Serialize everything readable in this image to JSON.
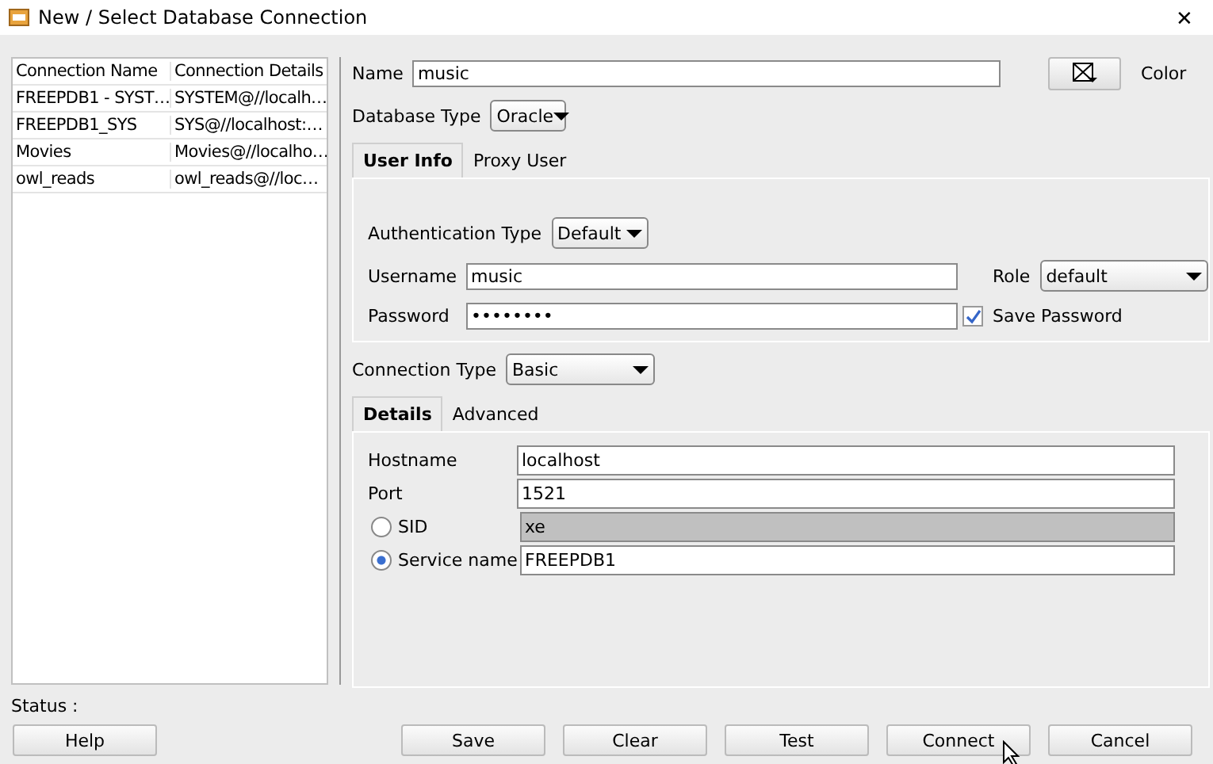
{
  "window": {
    "title": "New / Select Database Connection",
    "close": "✕"
  },
  "connections": {
    "columns": [
      "Connection Name",
      "Connection Details"
    ],
    "rows": [
      {
        "name": "FREEPDB1 - SYST…",
        "details": "SYSTEM@//localh…"
      },
      {
        "name": "FREEPDB1_SYS",
        "details": "SYS@//localhost:…"
      },
      {
        "name": "Movies",
        "details": "Movies@//localho…"
      },
      {
        "name": "owl_reads",
        "details": "owl_reads@//loc…"
      }
    ]
  },
  "name": {
    "label": "Name",
    "value": "music"
  },
  "color": {
    "label": "Color"
  },
  "database_type": {
    "label": "Database Type",
    "value": "Oracle"
  },
  "user_tabs": [
    {
      "label": "User Info",
      "selected": true
    },
    {
      "label": "Proxy User",
      "selected": false
    }
  ],
  "authentication_type": {
    "label": "Authentication Type",
    "value": "Default"
  },
  "username": {
    "label": "Username",
    "value": "music"
  },
  "password": {
    "label": "Password",
    "value": "••••••••"
  },
  "role": {
    "label": "Role",
    "value": "default"
  },
  "save_password": {
    "label": "Save Password",
    "checked": true
  },
  "connection_type": {
    "label": "Connection Type",
    "value": "Basic"
  },
  "detail_tabs": [
    {
      "label": "Details",
      "selected": true
    },
    {
      "label": "Advanced",
      "selected": false
    }
  ],
  "hostname": {
    "label": "Hostname",
    "value": "localhost"
  },
  "port": {
    "label": "Port",
    "value": "1521"
  },
  "sid": {
    "label": "SID",
    "value": "xe",
    "selected": false
  },
  "service_name": {
    "label": "Service name",
    "value": "FREEPDB1",
    "selected": true
  },
  "status": {
    "label": "Status :"
  },
  "buttons": [
    "Help",
    "Save",
    "Clear",
    "Test",
    "Connect",
    "Cancel"
  ]
}
